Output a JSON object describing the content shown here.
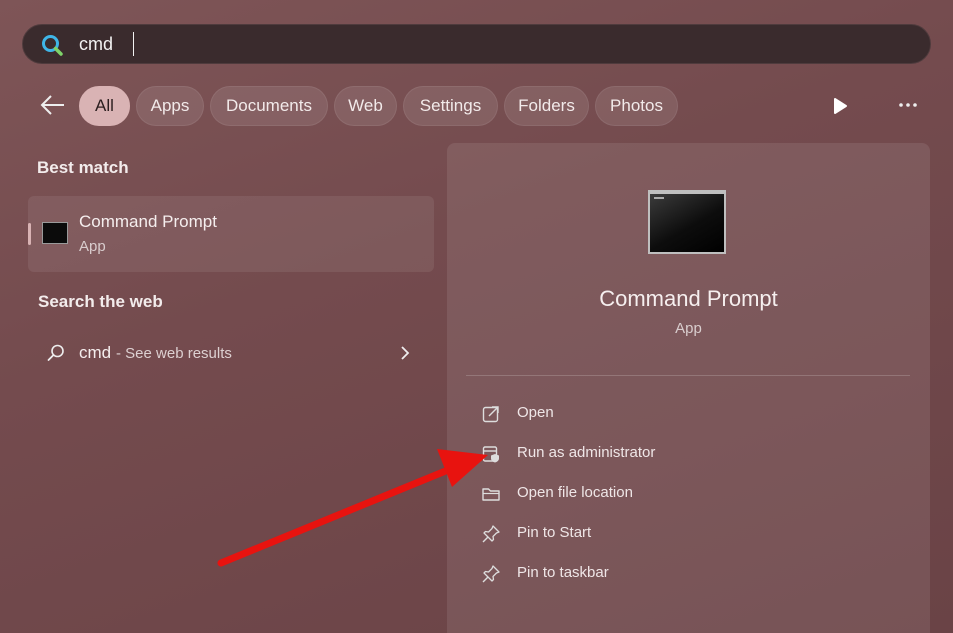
{
  "search": {
    "query": "cmd"
  },
  "filters": {
    "chips": [
      {
        "label": "All",
        "active": true
      },
      {
        "label": "Apps",
        "active": false
      },
      {
        "label": "Documents",
        "active": false
      },
      {
        "label": "Web",
        "active": false
      },
      {
        "label": "Settings",
        "active": false
      },
      {
        "label": "Folders",
        "active": false
      },
      {
        "label": "Photos",
        "active": false
      }
    ]
  },
  "best_match": {
    "heading": "Best match",
    "name": "Command Prompt",
    "type": "App"
  },
  "web": {
    "heading": "Search the web",
    "query": "cmd",
    "suffix": "- See web results"
  },
  "detail": {
    "name": "Command Prompt",
    "type": "App",
    "actions": [
      {
        "label": "Open",
        "icon": "open-external-icon"
      },
      {
        "label": "Run as administrator",
        "icon": "shield-admin-icon"
      },
      {
        "label": "Open file location",
        "icon": "folder-icon"
      },
      {
        "label": "Pin to Start",
        "icon": "pin-icon"
      },
      {
        "label": "Pin to taskbar",
        "icon": "pin-icon"
      }
    ]
  },
  "colors": {
    "accent": "#d9b3b4",
    "annotation_arrow": "#e8130f"
  }
}
